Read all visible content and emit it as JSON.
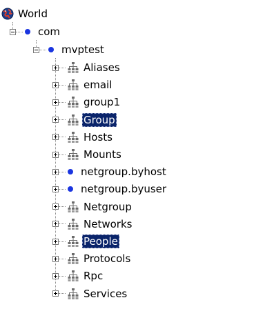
{
  "tree": {
    "root": {
      "label": "World",
      "icon": "globe-icon"
    },
    "com": {
      "label": "com",
      "icon": "blue-dot-icon"
    },
    "mvptest": {
      "label": "mvptest",
      "icon": "blue-dot-icon"
    },
    "children": [
      {
        "label": "Aliases",
        "icon": "network-table-icon",
        "selected": false
      },
      {
        "label": "email",
        "icon": "network-table-icon",
        "selected": false
      },
      {
        "label": "group1",
        "icon": "network-table-icon",
        "selected": false
      },
      {
        "label": "Group",
        "icon": "network-table-icon",
        "selected": true
      },
      {
        "label": "Hosts",
        "icon": "network-table-icon",
        "selected": false
      },
      {
        "label": "Mounts",
        "icon": "network-table-icon",
        "selected": false
      },
      {
        "label": "netgroup.byhost",
        "icon": "blue-dot-icon",
        "selected": false
      },
      {
        "label": "netgroup.byuser",
        "icon": "blue-dot-icon",
        "selected": false
      },
      {
        "label": "Netgroup",
        "icon": "network-table-icon",
        "selected": false
      },
      {
        "label": "Networks",
        "icon": "network-table-icon",
        "selected": false
      },
      {
        "label": "People",
        "icon": "network-table-icon",
        "selected": true
      },
      {
        "label": "Protocols",
        "icon": "network-table-icon",
        "selected": false
      },
      {
        "label": "Rpc",
        "icon": "network-table-icon",
        "selected": false
      },
      {
        "label": "Services",
        "icon": "network-table-icon",
        "selected": false
      }
    ]
  },
  "colors": {
    "selection_bg": "#0a246a",
    "selection_fg": "#ffffff",
    "dot": "#1a35e0"
  }
}
